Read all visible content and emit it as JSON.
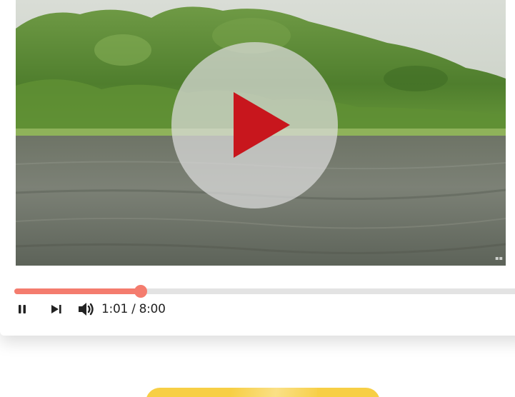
{
  "player": {
    "time_display": "1:01 / 8:00",
    "progress_fraction": 0.246,
    "state": "paused-overlay",
    "colors": {
      "accent": "#f47c6e",
      "play_triangle": "#c8161d",
      "overlay_circle": "#dcdcdc",
      "track": "#e3e3e3",
      "icon": "#222222"
    },
    "icons": {
      "big_play": "play-icon",
      "pause": "pause-icon",
      "next": "skip-next-icon",
      "volume": "volume-icon"
    }
  },
  "below": {
    "button_color": "#f7cf45"
  }
}
